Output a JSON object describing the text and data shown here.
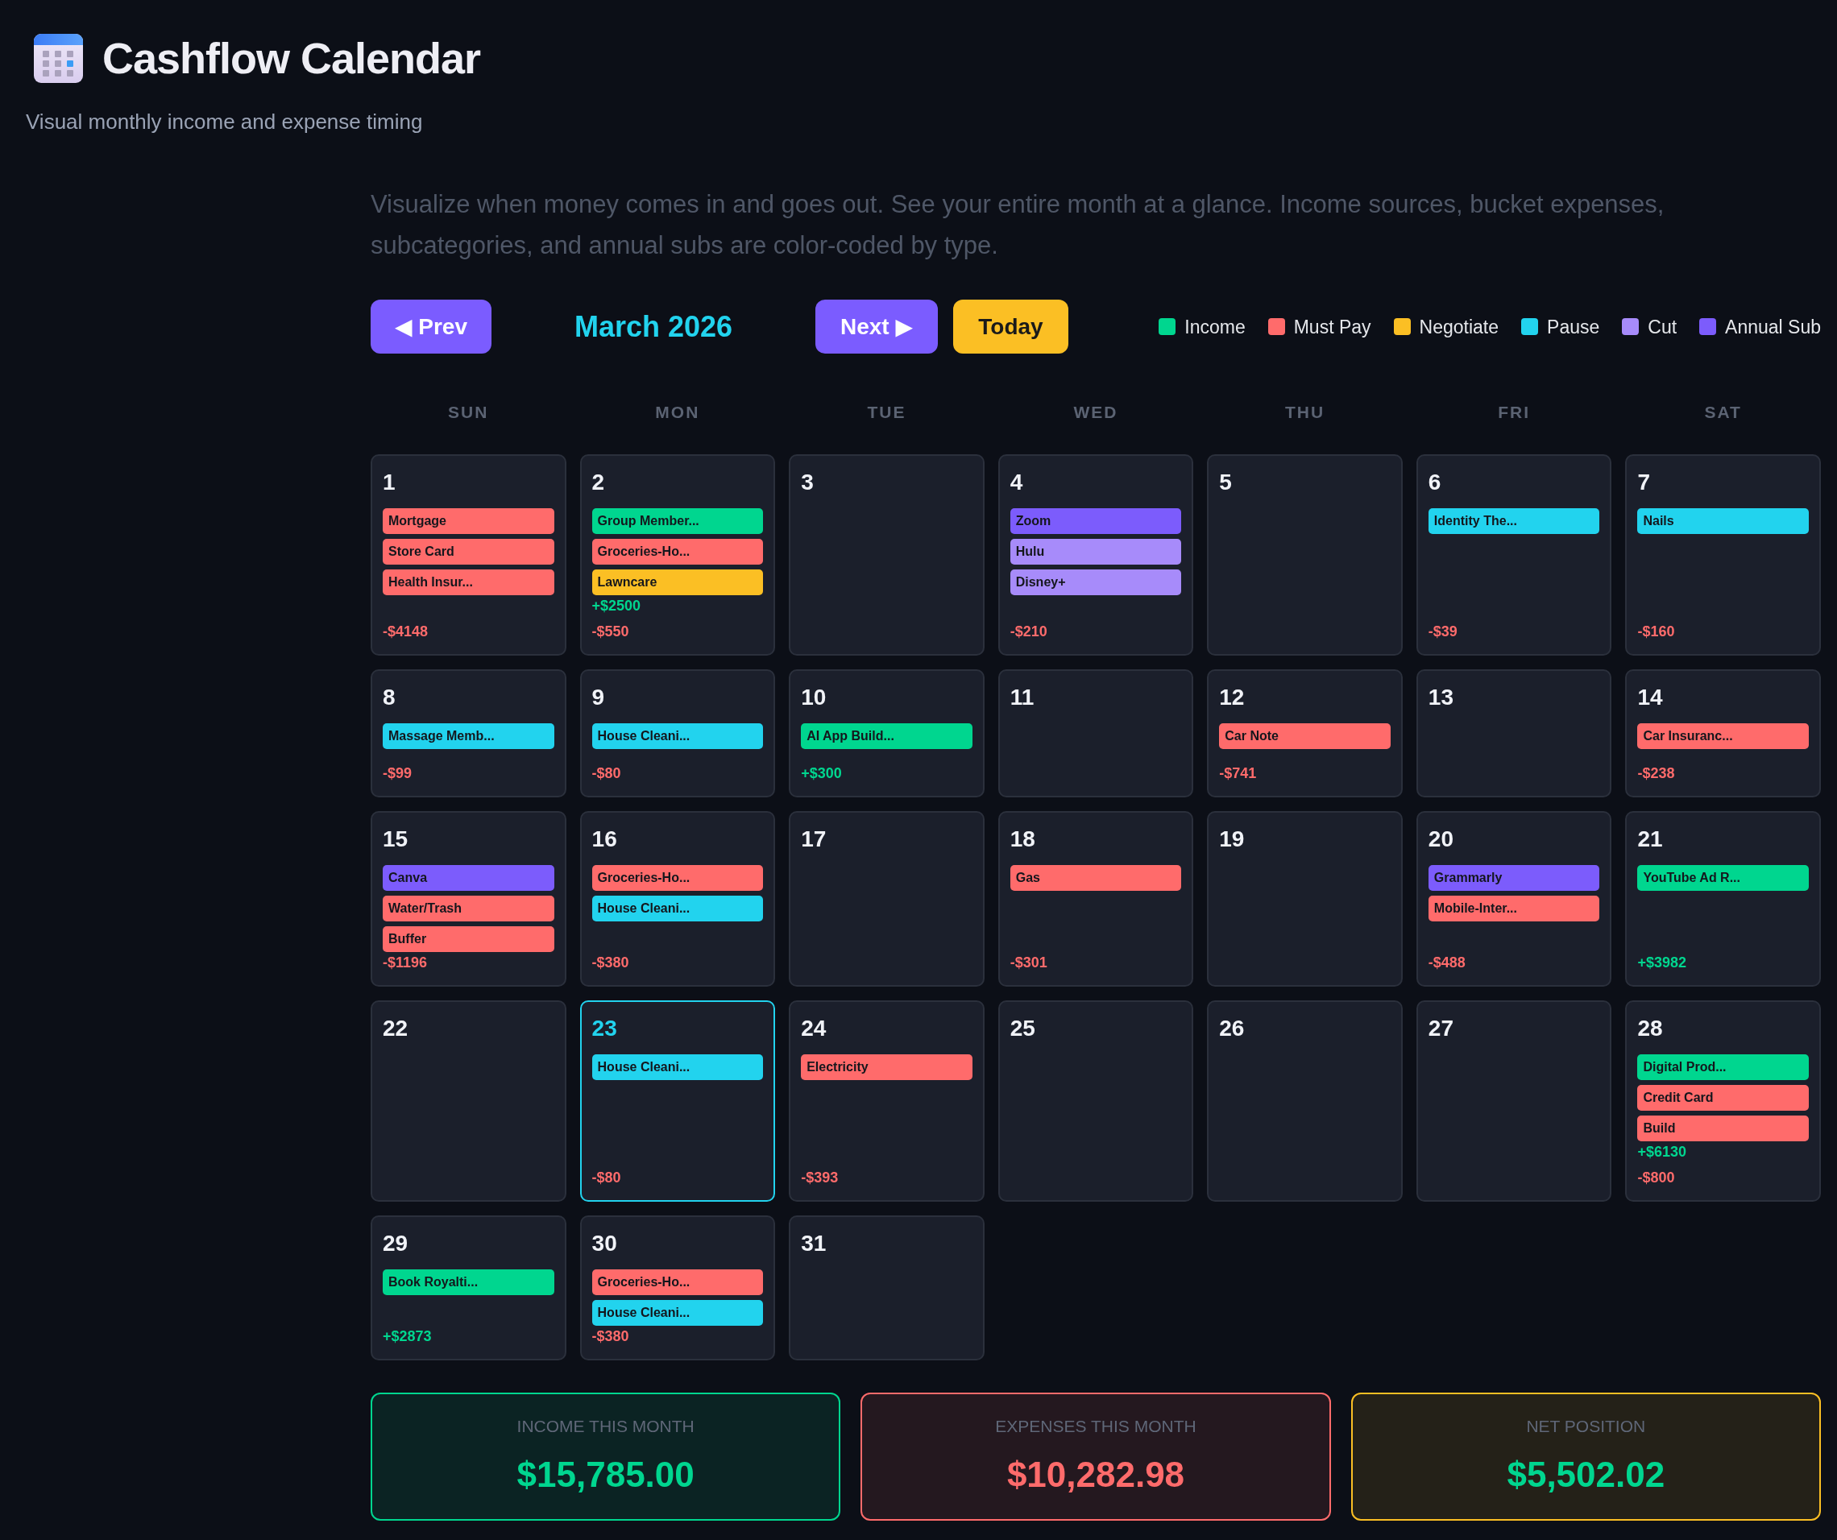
{
  "header": {
    "title": "Cashflow Calendar",
    "subtitle": "Visual monthly income and expense timing"
  },
  "description": "Visualize when money comes in and goes out. See your entire month at a glance. Income sources, bucket expenses, subcategories, and annual subs are color-coded by type.",
  "controls": {
    "prev_button": "◀ Prev",
    "month": "March 2026",
    "next_button": "Next ▶",
    "today_button": "Today"
  },
  "legend": [
    {
      "label": "Income",
      "color": "#00d68f"
    },
    {
      "label": "Must Pay",
      "color": "#ff6b6b"
    },
    {
      "label": "Negotiate",
      "color": "#fbbf24"
    },
    {
      "label": "Pause",
      "color": "#22d3ee"
    },
    {
      "label": "Cut",
      "color": "#a78bfa"
    },
    {
      "label": "Annual Sub",
      "color": "#7c5cfc"
    }
  ],
  "weekdays": [
    "SUN",
    "MON",
    "TUE",
    "WED",
    "THU",
    "FRI",
    "SAT"
  ],
  "days": [
    {
      "day": "1",
      "today": false,
      "entries": [
        {
          "label": "Mortgage",
          "color": "#ff6b6b"
        },
        {
          "label": "Store Card",
          "color": "#ff6b6b"
        },
        {
          "label": "Health Insur...",
          "color": "#ff6b6b"
        }
      ],
      "expense": "-$4148"
    },
    {
      "day": "2",
      "today": false,
      "entries": [
        {
          "label": "Group Member...",
          "color": "#00d68f"
        },
        {
          "label": "Groceries-Ho...",
          "color": "#ff6b6b"
        },
        {
          "label": "Lawncare",
          "color": "#fbbf24"
        }
      ],
      "income": "+$2500",
      "expense": "-$550"
    },
    {
      "day": "3",
      "today": false
    },
    {
      "day": "4",
      "today": false,
      "entries": [
        {
          "label": "Zoom",
          "color": "#7c5cfc"
        },
        {
          "label": "Hulu",
          "color": "#a78bfa"
        },
        {
          "label": "Disney+",
          "color": "#a78bfa"
        }
      ],
      "expense": "-$210"
    },
    {
      "day": "5",
      "today": false
    },
    {
      "day": "6",
      "today": false,
      "entries": [
        {
          "label": "Identity The...",
          "color": "#22d3ee"
        }
      ],
      "expense": "-$39"
    },
    {
      "day": "7",
      "today": false,
      "entries": [
        {
          "label": "Nails",
          "color": "#22d3ee"
        }
      ],
      "expense": "-$160"
    },
    {
      "day": "8",
      "today": false,
      "entries": [
        {
          "label": "Massage Memb...",
          "color": "#22d3ee"
        }
      ],
      "expense": "-$99"
    },
    {
      "day": "9",
      "today": false,
      "entries": [
        {
          "label": "House Cleani...",
          "color": "#22d3ee"
        }
      ],
      "expense": "-$80"
    },
    {
      "day": "10",
      "today": false,
      "entries": [
        {
          "label": "AI App Build...",
          "color": "#00d68f"
        }
      ],
      "income": "+$300"
    },
    {
      "day": "11",
      "today": false
    },
    {
      "day": "12",
      "today": false,
      "entries": [
        {
          "label": "Car Note",
          "color": "#ff6b6b"
        }
      ],
      "expense": "-$741"
    },
    {
      "day": "13",
      "today": false
    },
    {
      "day": "14",
      "today": false,
      "entries": [
        {
          "label": "Car Insuranc...",
          "color": "#ff6b6b"
        }
      ],
      "expense": "-$238"
    },
    {
      "day": "15",
      "today": false,
      "entries": [
        {
          "label": "Canva",
          "color": "#7c5cfc"
        },
        {
          "label": "Water/Trash",
          "color": "#ff6b6b"
        },
        {
          "label": "Buffer",
          "color": "#ff6b6b"
        }
      ],
      "expense": "-$1196"
    },
    {
      "day": "16",
      "today": false,
      "entries": [
        {
          "label": "Groceries-Ho...",
          "color": "#ff6b6b"
        },
        {
          "label": "House Cleani...",
          "color": "#22d3ee"
        }
      ],
      "expense": "-$380"
    },
    {
      "day": "17",
      "today": false
    },
    {
      "day": "18",
      "today": false,
      "entries": [
        {
          "label": "Gas",
          "color": "#ff6b6b"
        }
      ],
      "expense": "-$301"
    },
    {
      "day": "19",
      "today": false
    },
    {
      "day": "20",
      "today": false,
      "entries": [
        {
          "label": "Grammarly",
          "color": "#7c5cfc"
        },
        {
          "label": "Mobile-Inter...",
          "color": "#ff6b6b"
        }
      ],
      "expense": "-$488"
    },
    {
      "day": "21",
      "today": false,
      "entries": [
        {
          "label": "YouTube Ad R...",
          "color": "#00d68f"
        }
      ],
      "income": "+$3982"
    },
    {
      "day": "22",
      "today": false
    },
    {
      "day": "23",
      "today": true,
      "entries": [
        {
          "label": "House Cleani...",
          "color": "#22d3ee"
        }
      ],
      "expense": "-$80"
    },
    {
      "day": "24",
      "today": false,
      "entries": [
        {
          "label": "Electricity",
          "color": "#ff6b6b"
        }
      ],
      "expense": "-$393"
    },
    {
      "day": "25",
      "today": false
    },
    {
      "day": "26",
      "today": false
    },
    {
      "day": "27",
      "today": false
    },
    {
      "day": "28",
      "today": false,
      "entries": [
        {
          "label": "Digital Prod...",
          "color": "#00d68f"
        },
        {
          "label": "Credit Card",
          "color": "#ff6b6b"
        },
        {
          "label": "Build",
          "color": "#ff6b6b"
        }
      ],
      "income": "+$6130",
      "expense": "-$800"
    },
    {
      "day": "29",
      "today": false,
      "entries": [
        {
          "label": "Book Royalti...",
          "color": "#00d68f"
        }
      ],
      "income": "+$2873"
    },
    {
      "day": "30",
      "today": false,
      "entries": [
        {
          "label": "Groceries-Ho...",
          "color": "#ff6b6b"
        },
        {
          "label": "House Cleani...",
          "color": "#22d3ee"
        }
      ],
      "expense": "-$380"
    },
    {
      "day": "31",
      "today": false
    }
  ],
  "summary": [
    {
      "label": "INCOME THIS MONTH",
      "value": "$15,785.00",
      "color": "#00d68f",
      "positive": true
    },
    {
      "label": "EXPENSES THIS MONTH",
      "value": "$10,282.98",
      "color": "#ff6b6b",
      "positive": false
    },
    {
      "label": "NET POSITION",
      "value": "$5,502.02",
      "color": "#fbbf24",
      "positive": true
    }
  ]
}
